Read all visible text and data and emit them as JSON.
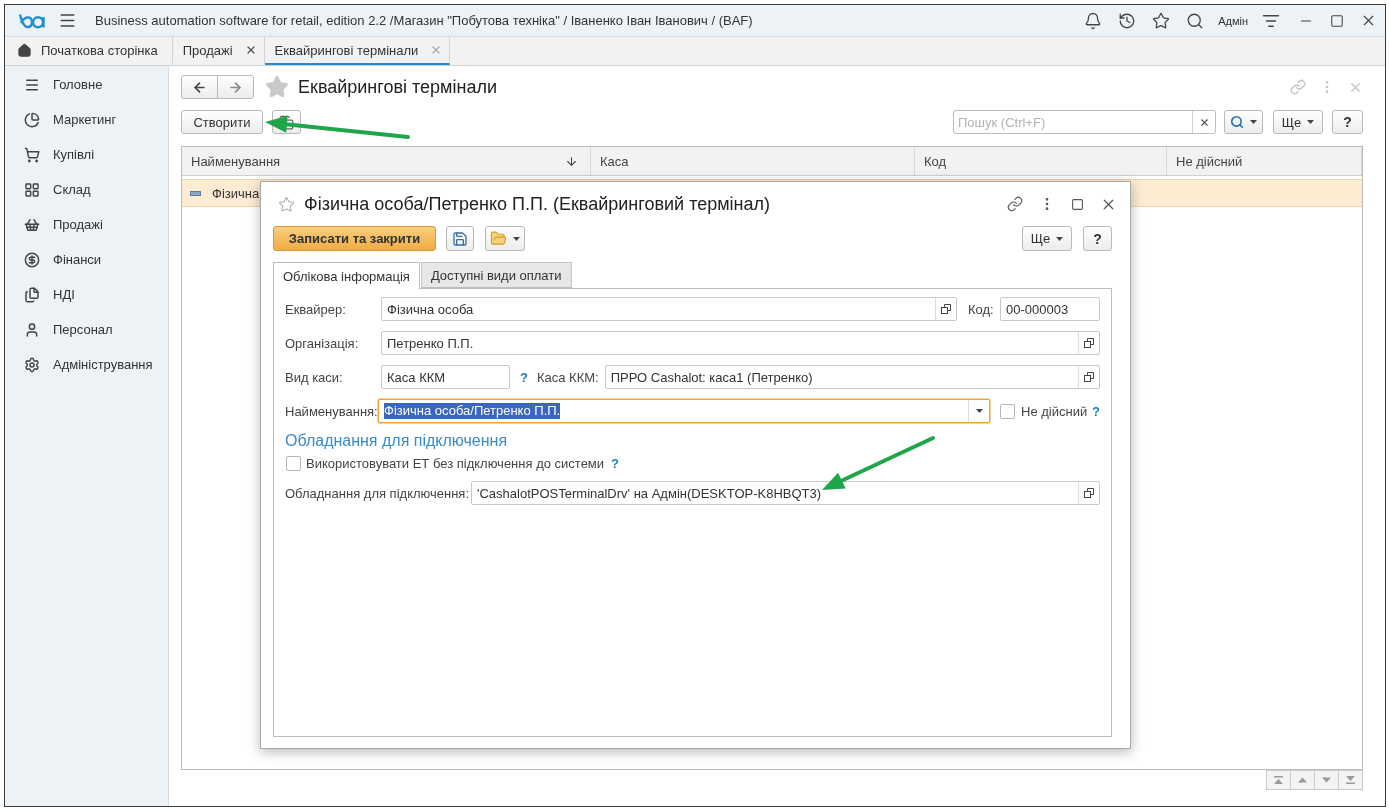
{
  "window": {
    "title": "Business automation software for retail, edition 2.2 /Магазин \"Побутова техніка\" / Іваненко Іван Іванович /  (BAF)",
    "user": "Адмін"
  },
  "tabs": [
    {
      "label": "Початкова сторінка",
      "kind": "home",
      "selected": false
    },
    {
      "label": "Продажі",
      "kind": "closable",
      "selected": false
    },
    {
      "label": "Еквайрингові термінали",
      "kind": "closable",
      "selected": true
    }
  ],
  "sidebar": {
    "items": [
      {
        "label": "Головне"
      },
      {
        "label": "Маркетинг"
      },
      {
        "label": "Купівлі"
      },
      {
        "label": "Склад"
      },
      {
        "label": "Продажі"
      },
      {
        "label": "Фінанси"
      },
      {
        "label": "НДІ"
      },
      {
        "label": "Персонал"
      },
      {
        "label": "Адміністрування"
      }
    ]
  },
  "list": {
    "title": "Еквайрингові термінали",
    "create_button": "Створити",
    "search": {
      "placeholder": "Пошук (Ctrl+F)"
    },
    "more_button": "Ще",
    "help_button": "?",
    "table": {
      "columns": [
        {
          "label": "Найменування",
          "sorted": true
        },
        {
          "label": "Каса",
          "sorted": false
        },
        {
          "label": "Код",
          "sorted": false
        },
        {
          "label": "Не дійсний",
          "sorted": false
        }
      ],
      "rows": [
        {
          "name": "Фізична",
          "selected": true
        }
      ]
    }
  },
  "dialog": {
    "title": "Фізична особа/Петренко П.П. (Еквайринговий термінал)",
    "save_close_button": "Записати та закрити",
    "more_button": "Ще",
    "help_button": "?",
    "tabs": [
      {
        "label": "Облікова інформація",
        "selected": true
      },
      {
        "label": "Доступні види оплати",
        "selected": false
      }
    ],
    "acquirer": {
      "label": "Еквайрер:",
      "value": "Фізична особа"
    },
    "code": {
      "label": "Код:",
      "value": "00-000003"
    },
    "organization": {
      "label": "Організація:",
      "value": "Петренко П.П."
    },
    "cash_type": {
      "label": "Вид каси:",
      "value": "Каса ККМ",
      "help": "?"
    },
    "cash_register": {
      "label": "Каса ККМ:",
      "value": "ПРРО Cashalot: каса1 (Петренко)"
    },
    "name": {
      "label": "Найменування:",
      "value": "Фізична особа/Петренко П.П.",
      "focused": true,
      "text_selected": true
    },
    "inactive": {
      "label": "Не дійсний",
      "checked": false,
      "help": "?"
    },
    "section_heading": "Обладнання для підключення",
    "offline_mode": {
      "label": "Використовувати ЕТ без підключення до системи",
      "checked": false,
      "help": "?"
    },
    "equipment": {
      "label": "Обладнання для підключення:",
      "value": "'CashalotPOSTerminalDrv' на Адмін(DESKTOP-K8HBQT3)"
    }
  }
}
